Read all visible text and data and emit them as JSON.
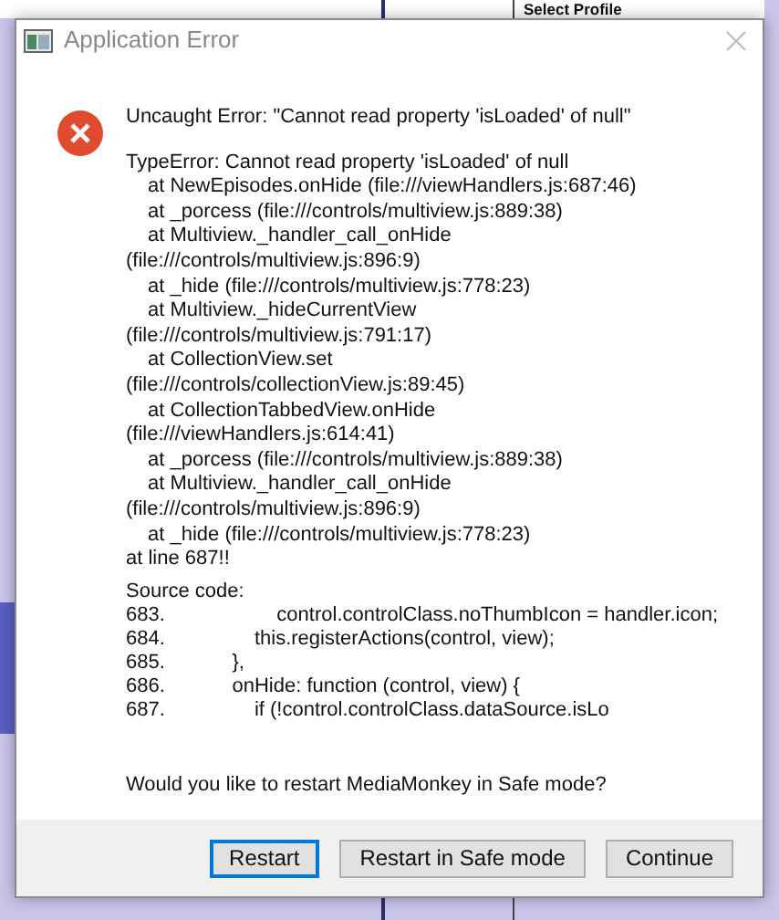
{
  "background": {
    "heading": "Select Profile"
  },
  "window": {
    "title": "Application Error"
  },
  "message": "Uncaught Error: \"Cannot read property 'isLoaded' of null\"",
  "trace": [
    {
      "text": "TypeError: Cannot read property 'isLoaded' of null",
      "kind": "plain"
    },
    {
      "text": "at NewEpisodes.onHide (file:///viewHandlers.js:687:46)",
      "kind": "frame"
    },
    {
      "text": "at _porcess (file:///controls/multiview.js:889:38)",
      "kind": "frame"
    },
    {
      "text": "at Multiview._handler_call_onHide",
      "kind": "frame"
    },
    {
      "text": "(file:///controls/multiview.js:896:9)",
      "kind": "plain"
    },
    {
      "text": "at _hide (file:///controls/multiview.js:778:23)",
      "kind": "frame"
    },
    {
      "text": "at Multiview._hideCurrentView",
      "kind": "frame"
    },
    {
      "text": "(file:///controls/multiview.js:791:17)",
      "kind": "plain"
    },
    {
      "text": "at CollectionView.set",
      "kind": "frame"
    },
    {
      "text": "(file:///controls/collectionView.js:89:45)",
      "kind": "plain"
    },
    {
      "text": "at CollectionTabbedView.onHide",
      "kind": "frame"
    },
    {
      "text": "(file:///viewHandlers.js:614:41)",
      "kind": "plain"
    },
    {
      "text": "at _porcess (file:///controls/multiview.js:889:38)",
      "kind": "frame"
    },
    {
      "text": "at Multiview._handler_call_onHide",
      "kind": "frame"
    },
    {
      "text": "(file:///controls/multiview.js:896:9)",
      "kind": "plain"
    },
    {
      "text": "at _hide (file:///controls/multiview.js:778:23)",
      "kind": "frame"
    },
    {
      "text": " at line 687!!",
      "kind": "plain"
    }
  ],
  "source_heading": "Source code:",
  "source_lines": [
    {
      "number": "683.",
      "code": "            control.controlClass.noThumbIcon = handler.icon;"
    },
    {
      "number": "684.",
      "code": "        this.registerActions(control, view);"
    },
    {
      "number": "685.",
      "code": "    },"
    },
    {
      "number": "686.",
      "code": "    onHide: function (control, view) {"
    },
    {
      "number": "687.",
      "code": "        if (!control.controlClass.dataSource.isLo"
    }
  ],
  "question": "Would you like to restart MediaMonkey in Safe mode?",
  "buttons": [
    {
      "label": "Restart",
      "focused": true
    },
    {
      "label": "Restart in Safe mode",
      "focused": false
    },
    {
      "label": "Continue",
      "focused": false
    }
  ]
}
